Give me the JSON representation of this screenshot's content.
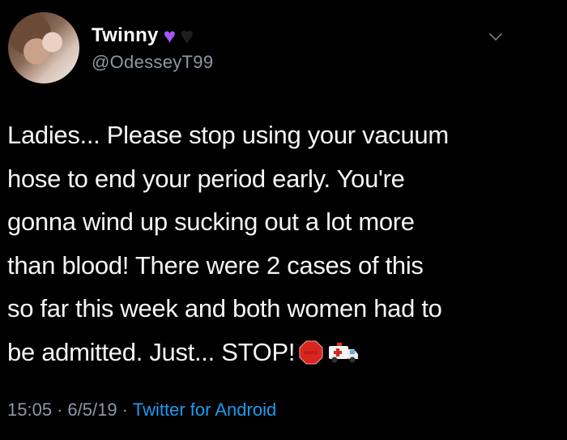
{
  "author": {
    "display_name": "Twinny",
    "handle": "@OdesseyT99",
    "badges": [
      "purple-heart",
      "black-heart"
    ]
  },
  "tweet": {
    "lines": [
      "Ladies... Please stop using your vacuum",
      "hose to end your period early. You're",
      "gonna wind up sucking out a lot more",
      "than blood! There were 2 cases of this",
      "so far this week and both women had to",
      "be admitted. Just... STOP!"
    ],
    "emojis": [
      "stop-sign-emoji",
      "ambulance-emoji"
    ]
  },
  "meta": {
    "time": "15:05",
    "separator": "·",
    "date": "6/5/19",
    "client": "Twitter for Android"
  },
  "colors": {
    "background": "#000000",
    "text": "#f5f5f5",
    "muted": "#8b98a5",
    "link": "#1d9bf0",
    "purple_heart": "#a855f7"
  }
}
